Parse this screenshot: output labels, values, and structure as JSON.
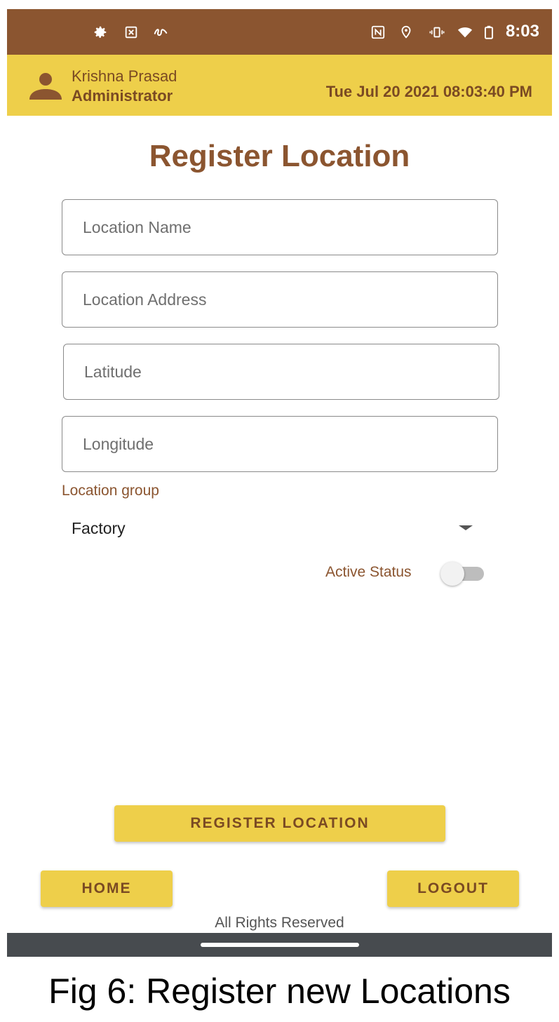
{
  "status_bar": {
    "time": "8:03",
    "left_icons": [
      "gear-icon",
      "sim-x-icon",
      "squiggle-icon"
    ],
    "right_icons": [
      "nfc-icon",
      "location-icon",
      "vibrate-icon",
      "wifi-icon",
      "battery-icon"
    ],
    "background": "#8b5530"
  },
  "header": {
    "user_name": "Krishna Prasad",
    "user_role": "Administrator",
    "datetime": "Tue Jul 20 2021 08:03:40 PM",
    "background": "#eecf4a"
  },
  "page": {
    "title": "Register Location"
  },
  "form": {
    "location_name": {
      "placeholder": "Location Name",
      "value": ""
    },
    "location_address": {
      "placeholder": "Location Address",
      "value": ""
    },
    "latitude": {
      "placeholder": "Latitude",
      "value": ""
    },
    "longitude": {
      "placeholder": "Longitude",
      "value": ""
    },
    "location_group": {
      "label": "Location group",
      "selected": "Factory"
    },
    "active_status": {
      "label": "Active Status",
      "on": false
    }
  },
  "buttons": {
    "register": "REGISTER LOCATION",
    "home": "HOME",
    "logout": "LOGOUT"
  },
  "footer": {
    "text": "All Rights Reserved"
  },
  "caption": "Fig 6: Register new Locations",
  "colors": {
    "accent_brown": "#8b5530",
    "accent_yellow": "#eecf4a",
    "nav_bar": "#474b4f"
  }
}
